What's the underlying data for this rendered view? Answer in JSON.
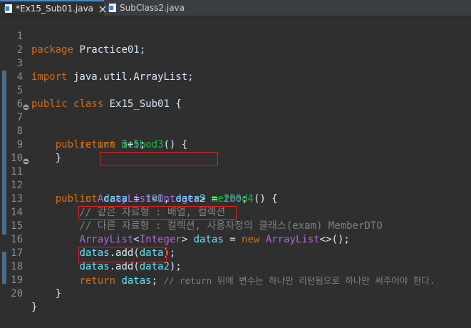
{
  "tabs": [
    {
      "label": "*Ex15_Sub01.java",
      "active": true
    },
    {
      "label": "SubClass2.java",
      "active": false
    }
  ],
  "icons": {
    "java_file": "java-file-icon",
    "close": "close-icon",
    "fold": "fold-minus-icon"
  },
  "colors": {
    "background": "#2f2f2f",
    "keyword": "#cc6c1d",
    "type": "#b166da",
    "number": "#6897bb",
    "method": "#1eb540",
    "variable": "#66e1f8",
    "comment": "#808080",
    "highlight_box": "#e02020"
  },
  "lines": [
    {
      "n": "1",
      "t": "package Practice01;"
    },
    {
      "n": "2",
      "t": ""
    },
    {
      "n": "3",
      "t": "import java.util.ArrayList;"
    },
    {
      "n": "4",
      "t": ""
    },
    {
      "n": "5",
      "t": "public class Ex15_Sub01 {"
    },
    {
      "n": "6",
      "t": ""
    },
    {
      "n": "7",
      "t": "    public int method3() {"
    },
    {
      "n": "8",
      "t": "        return 3+5;"
    },
    {
      "n": "9",
      "t": "    }"
    },
    {
      "n": "10",
      "t": ""
    },
    {
      "n": "11",
      "t": "    public ArrayList<Integer> method4() {"
    },
    {
      "n": "12",
      "t": "        int data = 100, data2 = 200;"
    },
    {
      "n": "13",
      "t": "        // 같은 자료형 : 배열, 컬렉션"
    },
    {
      "n": "14",
      "t": "        // 다른 자료형 : 컬렉션, 사용자정의 클래스(exam) MemberDTO"
    },
    {
      "n": "15",
      "t": "        ArrayList<Integer> datas = new ArrayList<>();"
    },
    {
      "n": "16",
      "t": "        datas.add(data);"
    },
    {
      "n": "17",
      "t": "        datas.add(data2);"
    },
    {
      "n": "18",
      "t": "        return datas; // return 뒤에 변수는 하나만 리턴됨으로 하나만 써주어야 한다."
    },
    {
      "n": "19",
      "t": "    }"
    },
    {
      "n": "20",
      "t": "}"
    }
  ],
  "tokens": {
    "package": "package",
    "pkg_rest": " Practice01;",
    "import": "import",
    "import_rest": " java.util.ArrayList;",
    "public": "public",
    "class": "class",
    "class_rest": " Ex15_Sub01 {",
    "int": "int",
    "method3": "method3",
    "m3_rest": "() {",
    "return": "return",
    "n3": "3",
    "plus": "+",
    "n5": "5",
    "semi": ";",
    "brace_close": "}",
    "arraylist": "ArrayList",
    "lt": "<",
    "integer": "Integer",
    "gt": ">",
    "method4": "method4",
    "m4_rest": "() {",
    "data": "data",
    "eq": " = ",
    "n100": "100",
    "comma": ", ",
    "data2": "data2",
    "n200": "200",
    "c13": "// 같은 자료형 : 배열, 컬렉션",
    "c14": "// 다른 자료형 : 컬렉션, 사용자정의 클래스(exam) MemberDTO",
    "datas": "datas",
    "new": "new",
    "diamond": "<>();",
    "dot_add": ".add(",
    "close_paren": ");",
    "c18": "// return 뒤에 변수는 하나만 리턴됨으로 하나만 써주어야 한다."
  }
}
